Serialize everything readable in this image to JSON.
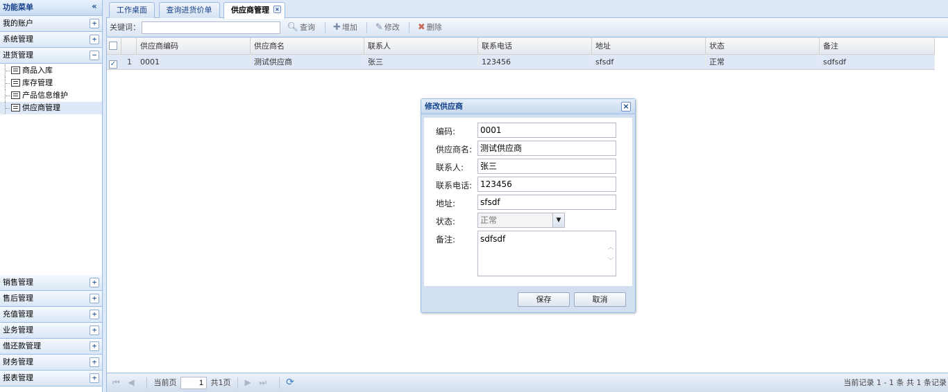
{
  "sidebar": {
    "title": "功能菜单",
    "collapse_symbol": "«",
    "groups_top": [
      {
        "label": "我的账户",
        "toggle": "+"
      },
      {
        "label": "系统管理",
        "toggle": "+"
      },
      {
        "label": "进货管理",
        "toggle": "−"
      }
    ],
    "tree_items": [
      {
        "label": "商品入库"
      },
      {
        "label": "库存管理"
      },
      {
        "label": "产品信息维护"
      },
      {
        "label": "供应商管理"
      }
    ],
    "groups_bottom": [
      {
        "label": "销售管理",
        "toggle": "+"
      },
      {
        "label": "售后管理",
        "toggle": "+"
      },
      {
        "label": "充值管理",
        "toggle": "+"
      },
      {
        "label": "业务管理",
        "toggle": "+"
      },
      {
        "label": "借还款管理",
        "toggle": "+"
      },
      {
        "label": "财务管理",
        "toggle": "+"
      },
      {
        "label": "报表管理",
        "toggle": "+"
      }
    ]
  },
  "tabs": [
    {
      "label": "工作桌面"
    },
    {
      "label": "查询进货价单"
    },
    {
      "label": "供应商管理"
    }
  ],
  "tab_close_symbol": "×",
  "toolbar": {
    "keyword_label": "关键词：",
    "keyword_value": "",
    "query": "查询",
    "add": "增加",
    "edit": "修改",
    "delete": "删除"
  },
  "grid": {
    "columns": [
      "供应商编码",
      "供应商名",
      "联系人",
      "联系电话",
      "地址",
      "状态",
      "备注"
    ],
    "rows": [
      {
        "num": "1",
        "checked": "✓",
        "code": "0001",
        "name": "测试供应商",
        "contact": "张三",
        "phone": "123456",
        "address": "sfsdf",
        "status": "正常",
        "note": "sdfsdf"
      }
    ]
  },
  "pager": {
    "current_page_label": "当前页",
    "page_value": "1",
    "total_pages": "共1页",
    "info": "当前记录 1 - 1 条 共 1 条记录"
  },
  "dialog": {
    "title": "修改供应商",
    "close_symbol": "×",
    "fields": {
      "code_label": "编码:",
      "code_value": "0001",
      "name_label": "供应商名:",
      "name_value": "测试供应商",
      "contact_label": "联系人:",
      "contact_value": "张三",
      "phone_label": "联系电话:",
      "phone_value": "123456",
      "address_label": "地址:",
      "address_value": "sfsdf",
      "status_label": "状态:",
      "status_value": "正常",
      "note_label": "备注:",
      "note_value": "sdfsdf"
    },
    "save": "保存",
    "cancel": "取消"
  },
  "colors": {
    "accent": "#15428b",
    "border": "#99bbe8",
    "selection": "#dfe8f6"
  }
}
